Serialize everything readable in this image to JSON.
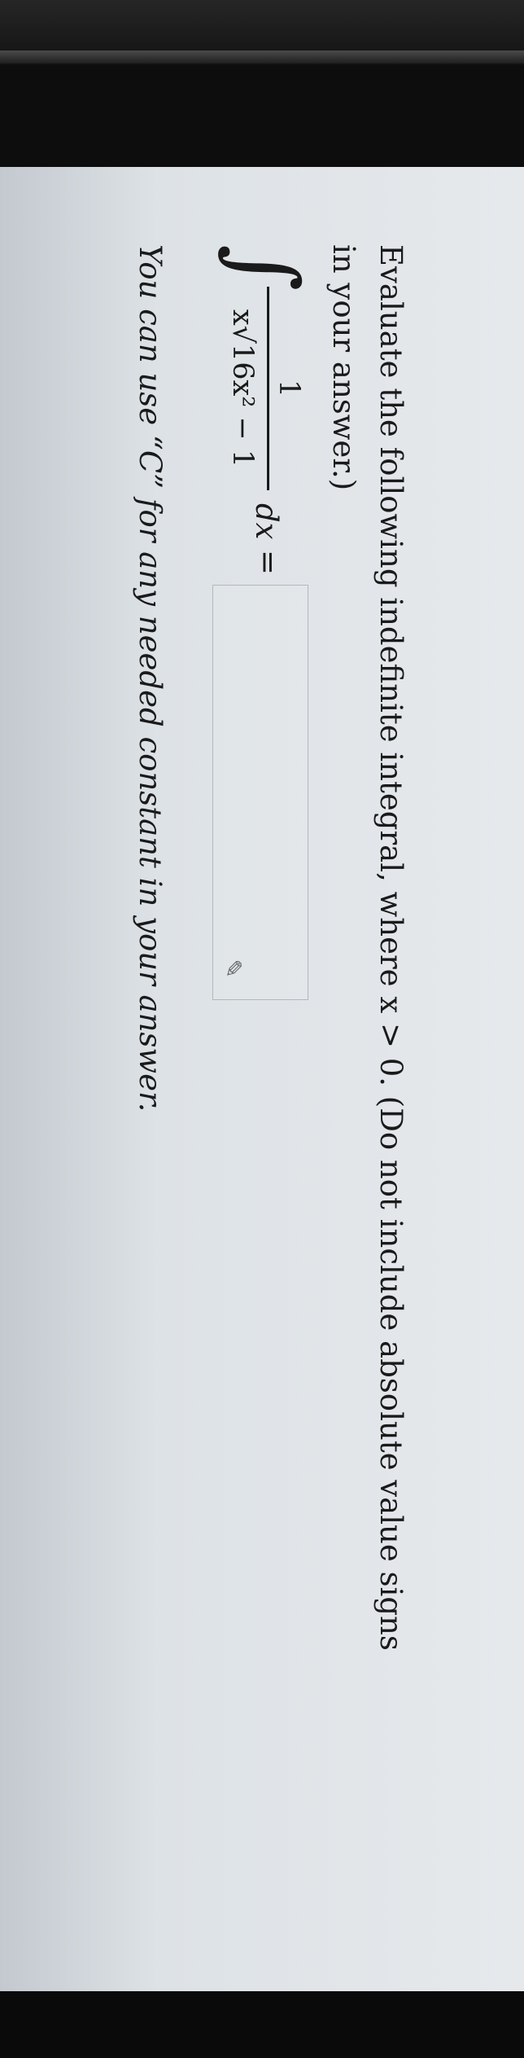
{
  "question": {
    "prompt": "Evaluate the following indefinite integral, where x > 0. (Do not include absolute value signs in your answer.)"
  },
  "math": {
    "integral_symbol": "∫",
    "numerator": "1",
    "denominator": "x√16x² − 1",
    "differential": "dx",
    "equals": "="
  },
  "answer": {
    "value": "",
    "icon": "pencil-icon"
  },
  "hint": {
    "text": "You can use “C” for any needed constant in your answer."
  }
}
